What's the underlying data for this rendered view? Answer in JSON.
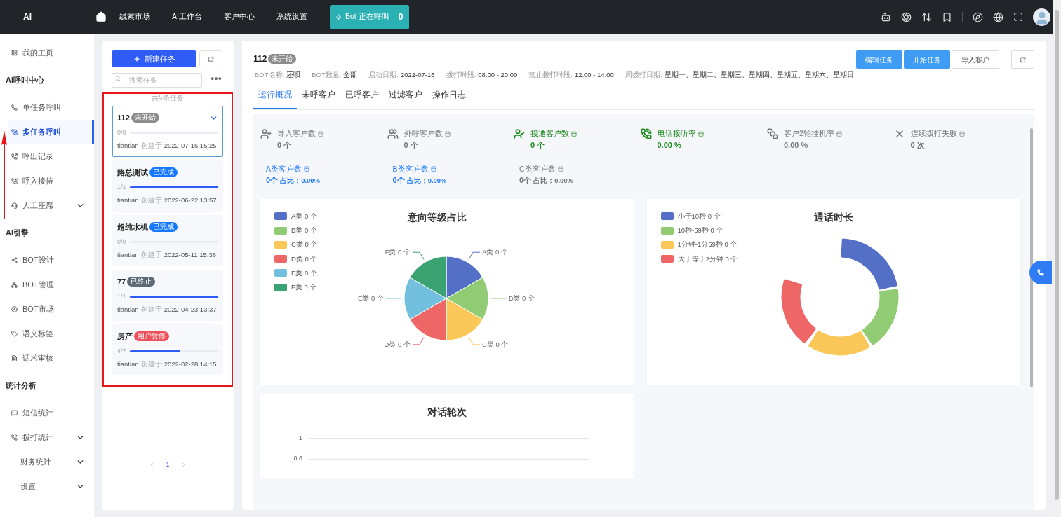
{
  "topbar": {
    "logo": "AI",
    "nav": [
      "线索市场",
      "AI工作台",
      "客户中心",
      "系统设置"
    ],
    "bot_status": {
      "label": "Bot 正在呼叫",
      "count": "0"
    }
  },
  "sidebar": {
    "items": [
      {
        "kind": "item",
        "label": "我的主页",
        "selected": false,
        "has_submenu": false
      },
      {
        "kind": "header",
        "label": "AI呼叫中心"
      },
      {
        "kind": "item",
        "label": "单任务呼叫",
        "selected": false,
        "has_submenu": false
      },
      {
        "kind": "item",
        "label": "多任务呼叫",
        "selected": true,
        "has_submenu": false
      },
      {
        "kind": "item",
        "label": "呼出记录",
        "selected": false,
        "has_submenu": false
      },
      {
        "kind": "item",
        "label": "呼入接待",
        "selected": false,
        "has_submenu": false
      },
      {
        "kind": "item",
        "label": "人工座席",
        "selected": false,
        "has_submenu": true
      },
      {
        "kind": "header",
        "label": "AI引擎"
      },
      {
        "kind": "item",
        "label": "BOT设计",
        "selected": false,
        "has_submenu": false
      },
      {
        "kind": "item",
        "label": "BOT管理",
        "selected": false,
        "has_submenu": false
      },
      {
        "kind": "item",
        "label": "BOT市场",
        "selected": false,
        "has_submenu": false
      },
      {
        "kind": "item",
        "label": "语义标签",
        "selected": false,
        "has_submenu": false
      },
      {
        "kind": "item",
        "label": "话术审核",
        "selected": false,
        "has_submenu": false
      },
      {
        "kind": "header",
        "label": "统计分析"
      },
      {
        "kind": "item",
        "label": "短信统计",
        "selected": false,
        "has_submenu": false
      },
      {
        "kind": "item",
        "label": "拨打统计",
        "selected": false,
        "has_submenu": true
      },
      {
        "kind": "item",
        "label": "财务统计",
        "selected": false,
        "has_submenu": true
      },
      {
        "kind": "item",
        "label": "设置",
        "selected": false,
        "has_submenu": true
      }
    ]
  },
  "task_panel": {
    "new_button": "新建任务",
    "search": {
      "placeholder": "搜索任务"
    },
    "count_label": "共5条任务",
    "tasks": [
      {
        "name": "112",
        "status": "未开始",
        "color": "#8c8c8c",
        "progress": "0/0",
        "level": 0,
        "owner": "tiantian",
        "created_label": "创建于",
        "created_at": "2022-07-16 15:25",
        "selected": true
      },
      {
        "name": "路总测试",
        "status": "已完成",
        "color": "#1677ff",
        "progress": "1/1",
        "level": 1,
        "owner": "tiantian",
        "created_label": "创建于",
        "created_at": "2022-06-22 13:57",
        "selected": false
      },
      {
        "name": "超纯水机",
        "status": "已完成",
        "color": "#1677ff",
        "progress": "0/0",
        "level": 0,
        "owner": "tiantian",
        "created_label": "创建于",
        "created_at": "2022-05-11 15:38",
        "selected": false
      },
      {
        "name": "77",
        "status": "已终止",
        "color": "#5c6b77",
        "progress": "1/1",
        "level": 1,
        "owner": "tiantian",
        "created_label": "创建于",
        "created_at": "2022-04-23 13:37",
        "selected": false
      },
      {
        "name": "房产",
        "status": "用户暂停",
        "color": "#ef4f5a",
        "progress": "4/7",
        "level": 0.57,
        "owner": "tiantian",
        "created_label": "创建于",
        "created_at": "2022-02-28 14:15",
        "selected": false
      }
    ],
    "pages": [
      {
        "label": "1",
        "selected": true
      }
    ]
  },
  "task_detail": {
    "name": "112",
    "status": "未开始",
    "actions": [
      {
        "label": "编辑任务",
        "kind": "primary"
      },
      {
        "label": "开始任务",
        "kind": "primary"
      },
      {
        "label": "导入客户",
        "kind": "default"
      }
    ],
    "info": [
      {
        "label": "BOT名称:",
        "value": "还呗"
      },
      {
        "label": "BOT数量:",
        "value": "全部"
      },
      {
        "label": "启动日期:",
        "value": "2022-07-16"
      },
      {
        "label": "拨打时段:",
        "value": "08:00 - 20:00"
      },
      {
        "label": "禁止拨打时段:",
        "value": "12:00 - 14:00"
      },
      {
        "label": "周拨打日期:",
        "value": "星期一、星期二、星期三、星期四、星期五、星期六、星期日"
      }
    ],
    "tabs": [
      {
        "label": "运行概况",
        "selected": true
      },
      {
        "label": "未呼客户",
        "selected": false
      },
      {
        "label": "已呼客户",
        "selected": false
      },
      {
        "label": "过滤客户",
        "selected": false
      },
      {
        "label": "操作日志",
        "selected": false
      }
    ],
    "metrics": [
      {
        "label": "导入客户数",
        "value": "0 个",
        "color": "#757575"
      },
      {
        "label": "外呼客户数",
        "value": "0 个",
        "color": "#757575"
      },
      {
        "label": "接通客户数",
        "value": "0 个",
        "color": "#1a8a1a"
      },
      {
        "label": "电话接听率",
        "value": "0.00 %",
        "color": "#1a8a1a"
      },
      {
        "label": "客户2轮挂机率",
        "value": "0.00 %",
        "color": "#757575"
      },
      {
        "label": "连续拨打失败",
        "value": "0 次",
        "color": "#757575"
      }
    ],
    "category_stats": [
      {
        "label": "A类客户数",
        "count": "0个",
        "ratio": "占比：0.00%",
        "color": "#1677ff"
      },
      {
        "label": "B类客户数",
        "count": "0个",
        "ratio": "占比：0.00%",
        "color": "#1677ff"
      },
      {
        "label": "C类客户数",
        "count": "0个",
        "ratio": "占比：0.00%",
        "color": "#757575"
      }
    ],
    "intent_chart": {
      "title": "意向等级占比",
      "legend": [
        {
          "label": "A类 0 个",
          "color": "#5470c6"
        },
        {
          "label": "B类 0 个",
          "color": "#91cc75"
        },
        {
          "label": "C类 0 个",
          "color": "#fac858"
        },
        {
          "label": "D类 0 个",
          "color": "#ee6666"
        },
        {
          "label": "E类 0 个",
          "color": "#73c0de"
        },
        {
          "label": "F类 0 个",
          "color": "#3ba272"
        }
      ],
      "slice_labels": [
        "A类 0 个",
        "B类 0 个",
        "C类 0 个",
        "D类 0 个",
        "E类 0 个",
        "F类 0 个"
      ]
    },
    "duration_chart": {
      "title": "通话时长",
      "legend": [
        {
          "label": "小于10秒 0 个",
          "color": "#5470c6"
        },
        {
          "label": "10秒-59秒 0 个",
          "color": "#91cc75"
        },
        {
          "label": "1分钟-1分59秒 0 个",
          "color": "#fac858"
        },
        {
          "label": "大于等于2分钟 0 个",
          "color": "#ee6666"
        }
      ]
    },
    "dialog_chart": {
      "title": "对话轮次",
      "axis_labels": [
        "1",
        "0.8"
      ]
    }
  }
}
